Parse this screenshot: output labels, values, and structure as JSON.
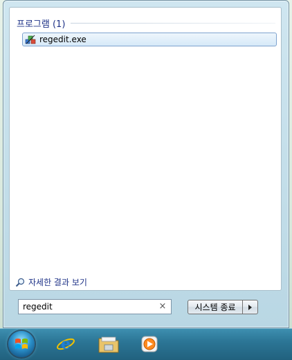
{
  "results": {
    "group_title": "프로그램 (1)",
    "items": [
      {
        "label": "regedit.exe",
        "icon": "regedit-icon"
      }
    ],
    "see_more": "자세한 결과 보기"
  },
  "search": {
    "value": "regedit",
    "clear_glyph": "×"
  },
  "shutdown": {
    "label": "시스템 종료"
  },
  "taskbar": {
    "pinned": [
      {
        "name": "internet-explorer-icon"
      },
      {
        "name": "windows-explorer-icon"
      },
      {
        "name": "media-player-icon"
      }
    ]
  },
  "colors": {
    "accent_text": "#1e3287",
    "taskbar": "#2c7696",
    "selection": "#d6e9f8"
  }
}
